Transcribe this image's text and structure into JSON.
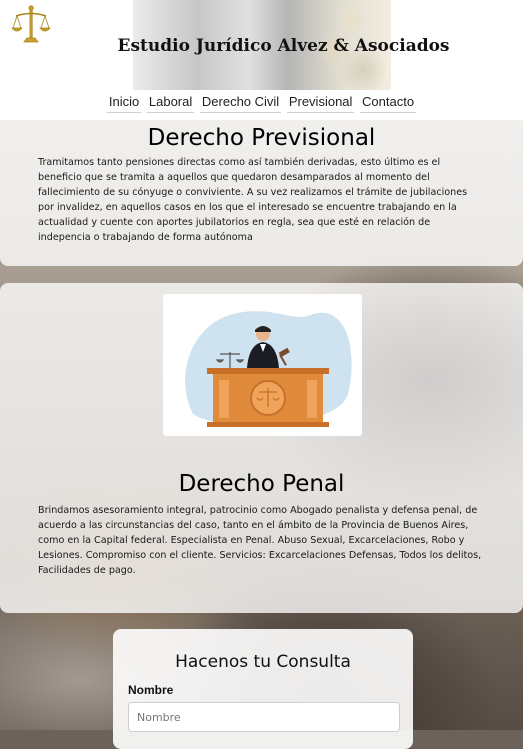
{
  "site": {
    "title": "Estudio Jurídico Alvez & Asociados"
  },
  "nav": {
    "items": [
      {
        "label": "Inicio"
      },
      {
        "label": "Laboral"
      },
      {
        "label": "Derecho Civil"
      },
      {
        "label": "Previsional"
      },
      {
        "label": "Contacto"
      }
    ]
  },
  "sections": {
    "previsional": {
      "title": "Derecho Previsional",
      "text": "Tramitamos tanto pensiones directas como así también derivadas, esto último es el beneficio que se tramita a aquellos que quedaron desamparados al momento del fallecimiento de su cónyuge o conviviente. A su vez realizamos el trámite de jubilaciones por invalidez, en aquellos casos en los que el interesado se encuentre trabajando en la actualidad y cuente con aportes jubilatorios en regla, sea que esté en relación de indepencia o trabajando de forma autónoma"
    },
    "penal": {
      "title": "Derecho Penal",
      "text": "Brindamos asesoramiento integral, patrocinio como Abogado penalista y defensa penal, de acuerdo a las circunstancias del caso, tanto en el ámbito de la Provincia de Buenos Aires, como en la Capital federal. Especialista en Penal. Abuso Sexual, Excarcelaciones, Robo y Lesiones. Compromiso con el cliente. Servicios: Excarcelaciones Defensas, Todos los delitos, Facilidades de pago."
    }
  },
  "contact_form": {
    "title": "Hacenos tu Consulta",
    "name_label": "Nombre",
    "name_placeholder": "Nombre"
  },
  "icons": {
    "logo": "scales-of-justice-icon",
    "illustration": "judge-at-bench-illustration"
  },
  "colors": {
    "logo_gold": "#c9a227",
    "bench_orange": "#e08a3c",
    "blob_blue": "#cfe2f0"
  }
}
